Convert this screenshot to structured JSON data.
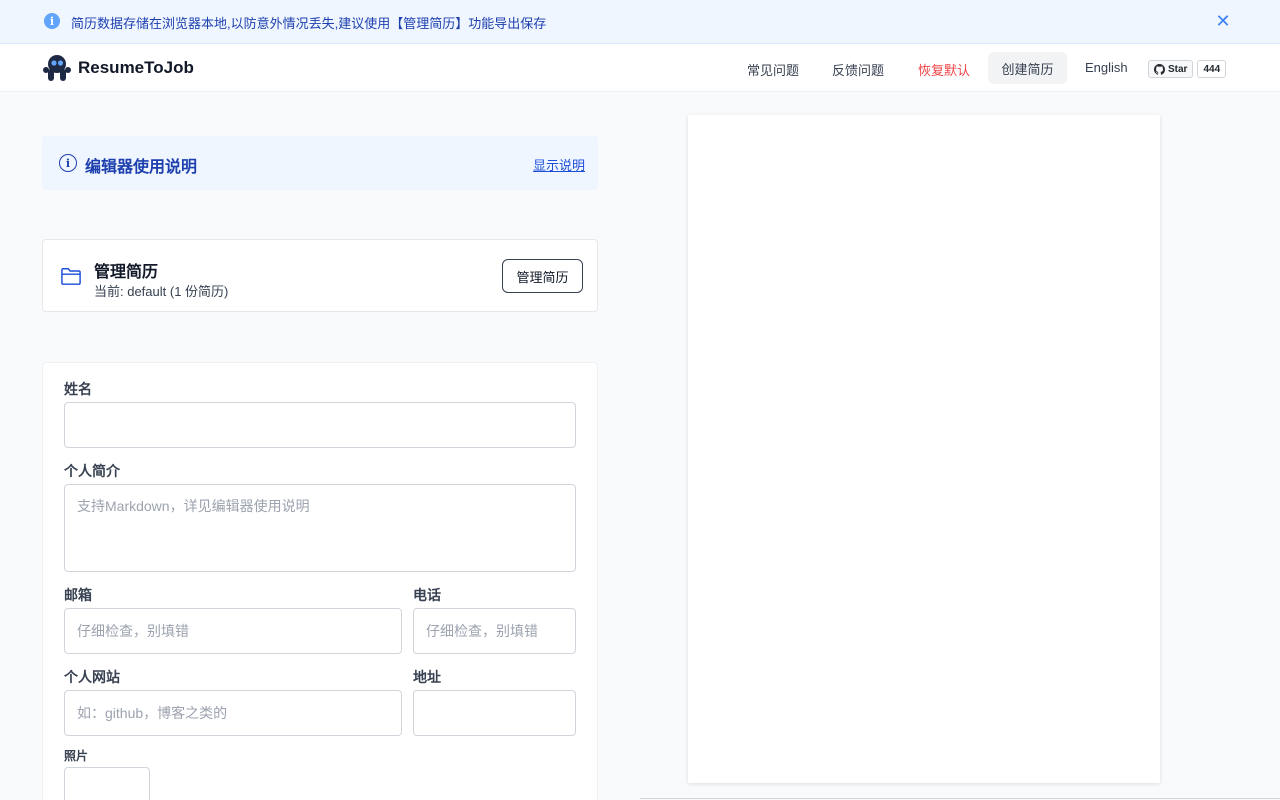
{
  "banner": {
    "text": "简历数据存储在浏览器本地,以防意外情况丢失,建议使用【管理简历】功能导出保存",
    "close_icon": "close-icon"
  },
  "nav": {
    "brand": "ResumeToJob",
    "faq": "常见问题",
    "feedback": "反馈问题",
    "reset": "恢复默认",
    "create": "创建简历",
    "language": "English",
    "github_star": "Star",
    "github_count": "444"
  },
  "instructions": {
    "title": "编辑器使用说明",
    "toggle": "显示说明"
  },
  "manage": {
    "title": "管理简历",
    "current": "当前: default (1 份简历)",
    "button": "管理简历"
  },
  "form": {
    "name_label": "姓名",
    "name_value": "",
    "bio_label": "个人简介",
    "bio_placeholder": "支持Markdown，详见编辑器使用说明",
    "email_label": "邮箱",
    "email_placeholder": "仔细检查，别填错",
    "phone_label": "电话",
    "phone_placeholder": "仔细检查，别填错",
    "website_label": "个人网站",
    "website_placeholder": "如：github，博客之类的",
    "address_label": "地址",
    "address_value": "",
    "photo_label": "照片"
  },
  "colors": {
    "accent": "#1e40af",
    "reset": "#ef4444",
    "banner_bg": "#eff6ff"
  }
}
